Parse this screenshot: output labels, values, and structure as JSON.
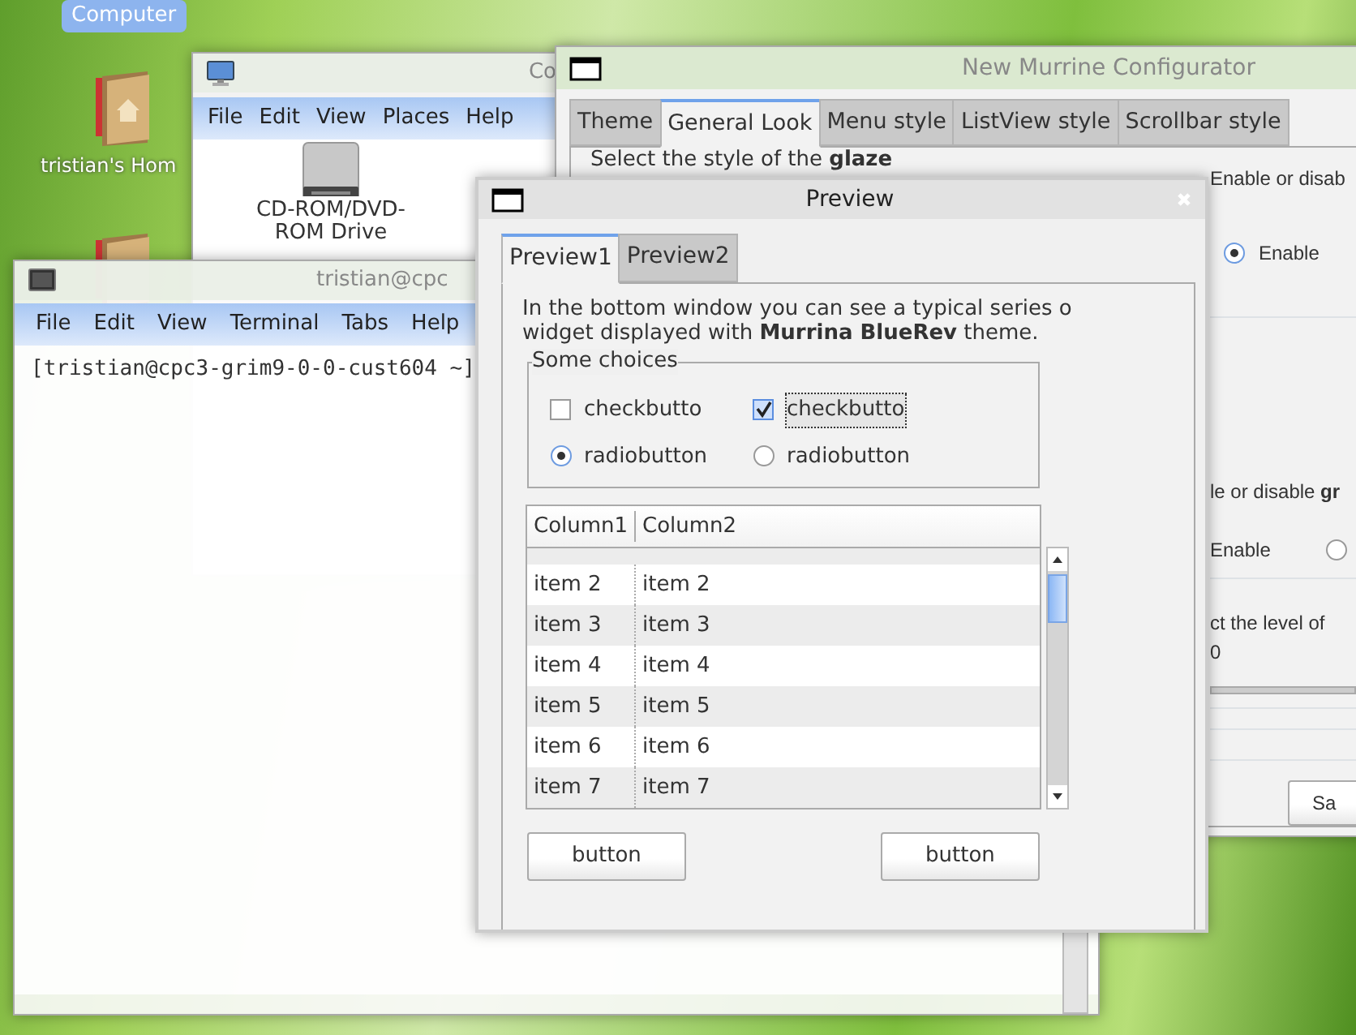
{
  "desktop_icons": [
    {
      "kind": "label",
      "label": "Computer",
      "selected": true
    },
    {
      "kind": "home",
      "label": "tristian's Hom",
      "selected": false
    },
    {
      "kind": "folder",
      "selected": false
    }
  ],
  "file_manager": {
    "title": "Co",
    "menu": [
      "File",
      "Edit",
      "View",
      "Places",
      "Help"
    ],
    "items": [
      {
        "kind": "drive",
        "label": "CD-ROM/DVD-ROM Drive"
      }
    ]
  },
  "terminal": {
    "title": "tristian@cpc",
    "menu": [
      "File",
      "Edit",
      "View",
      "Terminal",
      "Tabs",
      "Help"
    ],
    "lines": [
      "[tristian@cpc3-grim9-0-0-cust604 ~]"
    ]
  },
  "configurator": {
    "title": "New Murrine Configurator",
    "tabs": [
      {
        "label": "Theme",
        "selected": false
      },
      {
        "label": "General Look",
        "selected": true
      },
      {
        "label": "Menu style",
        "selected": false
      },
      {
        "label": "ListView style",
        "selected": false
      },
      {
        "label": "Scrollbar style",
        "selected": false
      }
    ],
    "glaze_label": "Select the style of the **glaze**",
    "option_1": {
      "label": "Enable or disab",
      "radio": {
        "label": "Enable",
        "selected": true
      }
    },
    "option_2": {
      "label": "le or disable **gr**",
      "enable_label": "Enable",
      "radio": {
        "selected": false
      }
    },
    "level_label": "ct the level of",
    "level_value": "0",
    "save_button": "Sa"
  },
  "preview": {
    "title": "Preview",
    "tabs": [
      {
        "label": "Preview1",
        "selected": true
      },
      {
        "label": "Preview2",
        "selected": false
      }
    ],
    "description": [
      "In the bottom window you can see a typical series o",
      "widget displayed with **Murrina BlueRev** theme."
    ],
    "frame": {
      "title": "Some choices",
      "checks": [
        {
          "label": "checkbutto",
          "checked": false,
          "focused": false
        },
        {
          "label": "checkbutto",
          "checked": true,
          "focused": true
        }
      ],
      "radios": [
        {
          "label": "radiobutton",
          "selected": true
        },
        {
          "label": "radiobutton",
          "selected": false
        }
      ]
    },
    "list": {
      "columns": [
        "Column1",
        "Column2"
      ],
      "rows": [
        [
          "item 2",
          "item 2"
        ],
        [
          "item 3",
          "item 3"
        ],
        [
          "item 4",
          "item 4"
        ],
        [
          "item 5",
          "item 5"
        ],
        [
          "item 6",
          "item 6"
        ],
        [
          "item 7",
          "item 7"
        ]
      ]
    },
    "buttons": [
      "button",
      "button"
    ]
  }
}
